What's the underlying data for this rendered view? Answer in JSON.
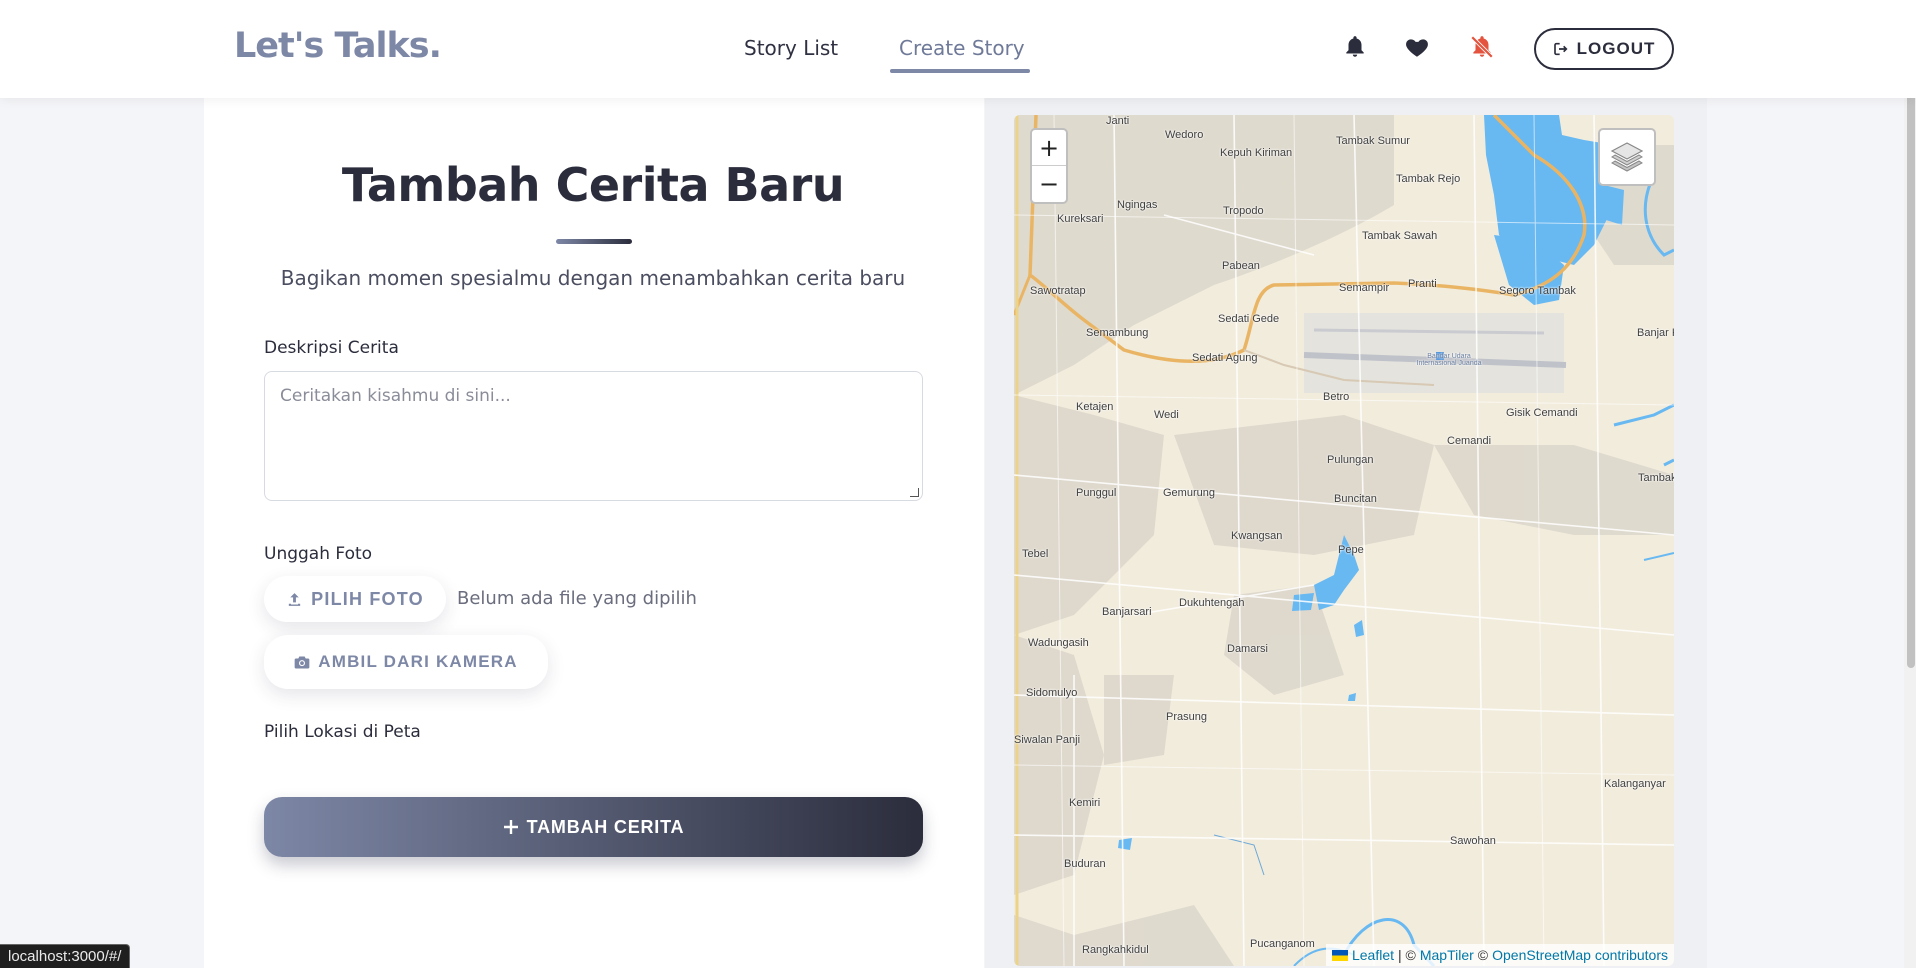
{
  "header": {
    "brand": "Let's Talks.",
    "nav": {
      "story_list": "Story List",
      "create_story": "Create Story"
    },
    "logout_label": "LOGOUT"
  },
  "form": {
    "title": "Tambah Cerita Baru",
    "subtitle": "Bagikan momen spesialmu dengan menambahkan cerita baru",
    "description_label": "Deskripsi Cerita",
    "description_placeholder": "Ceritakan kisahmu di sini...",
    "photo_label": "Unggah Foto",
    "choose_photo_label": "PILIH FOTO",
    "no_file_text": "Belum ada file yang dipilih",
    "camera_label": "AMBIL DARI KAMERA",
    "location_label": "Pilih Lokasi di Peta",
    "submit_label": "TAMBAH CERITA"
  },
  "map": {
    "zoom_in": "+",
    "zoom_out": "−",
    "attribution": {
      "leaflet": "Leaflet",
      "sep1": "| ©",
      "maptiler": "MapTiler",
      "sep2": "©",
      "osm": "OpenStreetMap contributors"
    },
    "places": [
      "Janti",
      "Wedoro",
      "Kepuh Kiriman",
      "Tambak Sumur",
      "Tambak Rejo",
      "Ngingas",
      "Tropodo",
      "Kureksari",
      "Tambak Sawah",
      "Pabean",
      "Sawotratap",
      "Semampir",
      "Pranti",
      "Segoro Tambak",
      "Semambung",
      "Sedati Gede",
      "Sedati Agung",
      "Banjar Ke",
      "Betro",
      "Gisik Cemandi",
      "Ketajen",
      "Wedi",
      "Cemandi",
      "Pulungan",
      "Punggul",
      "Gemurung",
      "Buncitan",
      "Tambak C",
      "Kwangsan",
      "Pepe",
      "Tebel",
      "Banjarsari",
      "Dukuhtengah",
      "Wadungasih",
      "Damarsi",
      "Sidomulyo",
      "Prasung",
      "Siwalan Panji",
      "Kalanganyar",
      "Kemiri",
      "Sawohan",
      "Buduran",
      "Rangkahkidul",
      "Pucanganom",
      "Bandar Udara Internasional Juanda"
    ]
  },
  "status_bar": "localhost:3000/#/",
  "colors": {
    "brand": "#7d87a6",
    "dark": "#2b2d3c",
    "bell_off": "#e4533d",
    "water": "#68b8f2"
  },
  "icons": [
    "bell-icon",
    "heart-icon",
    "bell-off-icon",
    "logout-icon",
    "upload-icon",
    "camera-icon",
    "plus-icon",
    "layers-icon"
  ]
}
